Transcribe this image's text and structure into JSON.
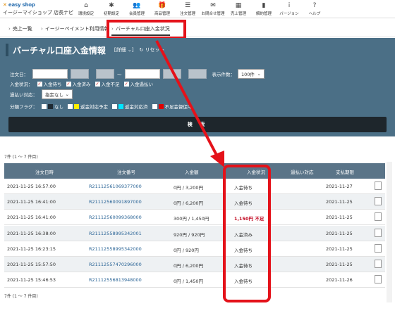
{
  "logo": {
    "brand": "easy shop",
    "store": "イージーマイショップ 店長ナビ"
  },
  "nav": [
    {
      "icon": "home-icon",
      "glyph": "⌂",
      "label": "環境設定"
    },
    {
      "icon": "gear-icon",
      "glyph": "✱",
      "label": "初期設定"
    },
    {
      "icon": "users-icon",
      "glyph": "👥",
      "label": "会員管理"
    },
    {
      "icon": "gift-icon",
      "glyph": "🎁",
      "label": "商品管理"
    },
    {
      "icon": "list-icon",
      "glyph": "☰",
      "label": "注文管理"
    },
    {
      "icon": "mail-icon",
      "glyph": "✉",
      "label": "お問合せ管理"
    },
    {
      "icon": "calc-icon",
      "glyph": "▦",
      "label": "売上管理"
    },
    {
      "icon": "bar-icon",
      "glyph": "▮",
      "label": "解約管理"
    },
    {
      "icon": "info-icon",
      "glyph": "i",
      "label": "バージョン"
    },
    {
      "icon": "help-icon",
      "glyph": "?",
      "label": "ヘルプ"
    }
  ],
  "breadcrumb": [
    "売上一覧",
    "イージーペイメント利用情報",
    "バーチャル口座入金状況"
  ],
  "panel": {
    "title": "バーチャル口座入金情報",
    "detail": "[詳細 ⌄]",
    "reset": "↻ リセット",
    "order_date_label": "注文日：",
    "tilde": "～",
    "display_count_label": "表示件数：",
    "display_count": "100件",
    "deposit_status_label": "入金状況：",
    "deposit_status": [
      "入金待ち",
      "入金済み",
      "入金不足",
      "入金過払い"
    ],
    "overpay_label": "過払い対応：",
    "overpay_value": "指定なし",
    "flag_label": "分類フラグ：",
    "flags": [
      {
        "label": "なし",
        "color": "#ffffff"
      },
      {
        "label": "返金対応予定",
        "color": "#ffef00"
      },
      {
        "label": "返金対応済",
        "color": "#00e5ff"
      },
      {
        "label": "不足金督促中",
        "color": "#e00000"
      }
    ],
    "search_label": "検 索"
  },
  "results": {
    "count_top": "7件 (1 ～ 7 件目)",
    "count_bottom": "7件 (1 ～ 7 件目)",
    "headers": [
      "注文日時",
      "注文番号",
      "入金額",
      "入金状況",
      "過払い対応",
      "支払期限"
    ],
    "rows": [
      {
        "date": "2021-11-25 16:57:00",
        "order": "R21112561069377000",
        "amount": "0円 / 3,200円",
        "status": "入金待ち",
        "due": "2021-11-27",
        "red": false
      },
      {
        "date": "2021-11-25 16:41:00",
        "order": "R21112560091897000",
        "amount": "0円 / 6,200円",
        "status": "入金待ち",
        "due": "2021-11-25",
        "red": false
      },
      {
        "date": "2021-11-25 16:41:00",
        "order": "R21112560099368000",
        "amount": "300円 / 1,450円",
        "status": "1,150円 不足",
        "due": "2021-11-25",
        "red": true
      },
      {
        "date": "2021-11-25 16:38:00",
        "order": "R21112558995342001",
        "amount": "920円 / 920円",
        "status": "入金済み",
        "due": "2021-11-25",
        "red": false
      },
      {
        "date": "2021-11-25 16:23:15",
        "order": "R21112558995342000",
        "amount": "0円 / 920円",
        "status": "入金待ち",
        "due": "2021-11-25",
        "red": false
      },
      {
        "date": "2021-11-25 15:57:50",
        "order": "R21112557470296000",
        "amount": "0円 / 6,200円",
        "status": "入金待ち",
        "due": "2021-11-25",
        "red": false
      },
      {
        "date": "2021-11-25 15:46:53",
        "order": "R21112556813948000",
        "amount": "0円 / 1,450円",
        "status": "入金待ち",
        "due": "2021-11-26",
        "red": false
      }
    ]
  }
}
